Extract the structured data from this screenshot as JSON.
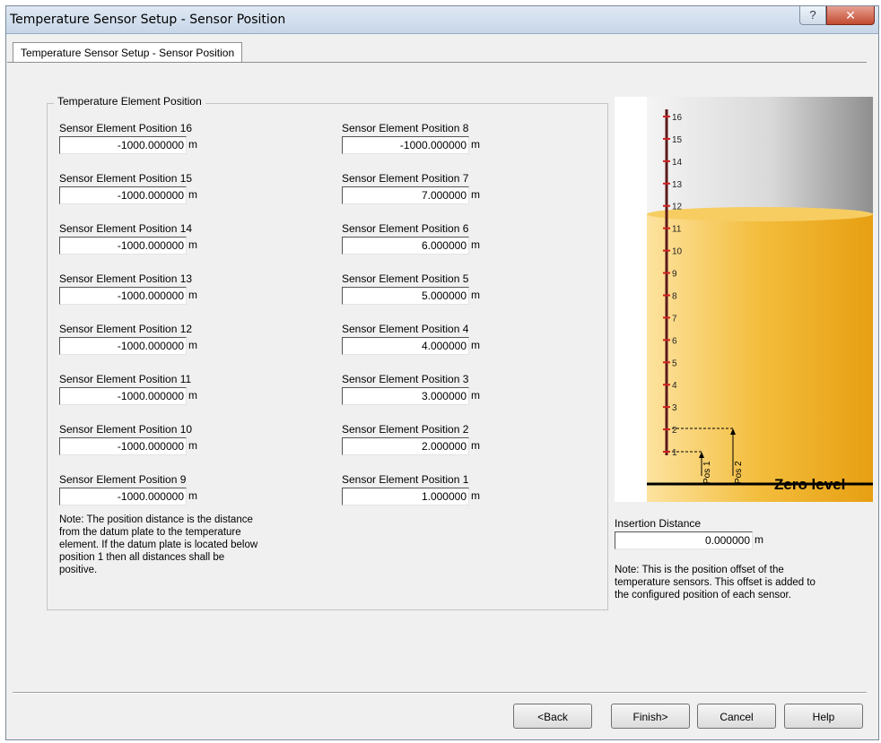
{
  "window": {
    "title": "Temperature Sensor Setup - Sensor Position",
    "help": "?",
    "close": "✕"
  },
  "tab": {
    "label": "Temperature Sensor Setup - Sensor Position"
  },
  "group": {
    "title": "Temperature Element Position"
  },
  "unit": "m",
  "left_fields": [
    {
      "label": "Sensor Element Position 16",
      "value": "-1000.000000"
    },
    {
      "label": "Sensor Element Position 15",
      "value": "-1000.000000"
    },
    {
      "label": "Sensor Element Position 14",
      "value": "-1000.000000"
    },
    {
      "label": "Sensor Element Position 13",
      "value": "-1000.000000"
    },
    {
      "label": "Sensor Element Position 12",
      "value": "-1000.000000"
    },
    {
      "label": "Sensor Element Position 11",
      "value": "-1000.000000"
    },
    {
      "label": "Sensor Element Position 10",
      "value": "-1000.000000"
    },
    {
      "label": "Sensor Element Position 9",
      "value": "-1000.000000"
    }
  ],
  "right_fields": [
    {
      "label": "Sensor Element Position 8",
      "value": "-1000.000000"
    },
    {
      "label": "Sensor Element Position 7",
      "value": "7.000000"
    },
    {
      "label": "Sensor Element Position 6",
      "value": "6.000000"
    },
    {
      "label": "Sensor Element Position 5",
      "value": "5.000000"
    },
    {
      "label": "Sensor Element Position 4",
      "value": "4.000000"
    },
    {
      "label": "Sensor Element Position 3",
      "value": "3.000000"
    },
    {
      "label": "Sensor Element Position 2",
      "value": "2.000000"
    },
    {
      "label": "Sensor Element Position 1",
      "value": "1.000000"
    }
  ],
  "note_position": [
    "Note: The position distance is the distance",
    "from the datum plate to the temperature",
    "element. If the datum plate is located below",
    "position 1 then all distances shall be",
    "positive."
  ],
  "diagram": {
    "ticks": [
      "16",
      "15",
      "14",
      "13",
      "12",
      "11",
      "10",
      "9",
      "8",
      "7",
      "6",
      "5",
      "4",
      "3",
      "2",
      "1"
    ],
    "pos1": "Pos 1",
    "pos2": "Pos 2",
    "zero": "Zero level",
    "colors": {
      "liquid": "#f0b830",
      "gas": "#d6d6d6",
      "probe": "#5a1a1a",
      "marker": "#d02020"
    }
  },
  "insertion": {
    "label": "Insertion Distance",
    "value": "0.000000",
    "unit": "m"
  },
  "note_offset": [
    "Note: This is the position offset of the",
    "temperature sensors. This offset is added to",
    "the configured position of each sensor."
  ],
  "buttons": {
    "back": "<Back",
    "finish": "Finish>",
    "cancel": "Cancel",
    "help": "Help"
  }
}
